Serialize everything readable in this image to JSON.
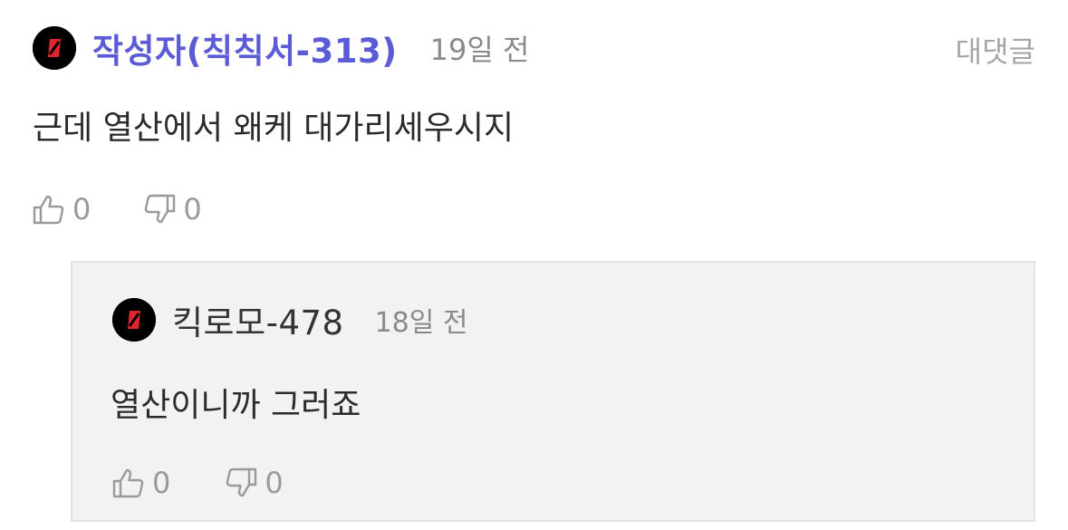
{
  "comment": {
    "author": "작성자(칙칙서-313)",
    "time": "19일 전",
    "reply_label": "대댓글",
    "text": "근데 열산에서 왜케 대가리세우시지",
    "likes": "0",
    "dislikes": "0",
    "avatar_icon": "red-stripe-logo-icon"
  },
  "reply": {
    "author": "킥로모-478",
    "time": "18일 전",
    "text": "열산이니까 그러죠",
    "likes": "0",
    "dislikes": "0",
    "avatar_icon": "red-stripe-logo-icon"
  },
  "colors": {
    "author_accent": "#5b5bd6",
    "avatar_bg": "#000000",
    "avatar_mark": "#e0262b",
    "reply_bg": "#f1f2f4",
    "muted_text": "#8a8a8a"
  },
  "icons": {
    "like": "thumbs-up-icon",
    "dislike": "thumbs-down-icon"
  }
}
